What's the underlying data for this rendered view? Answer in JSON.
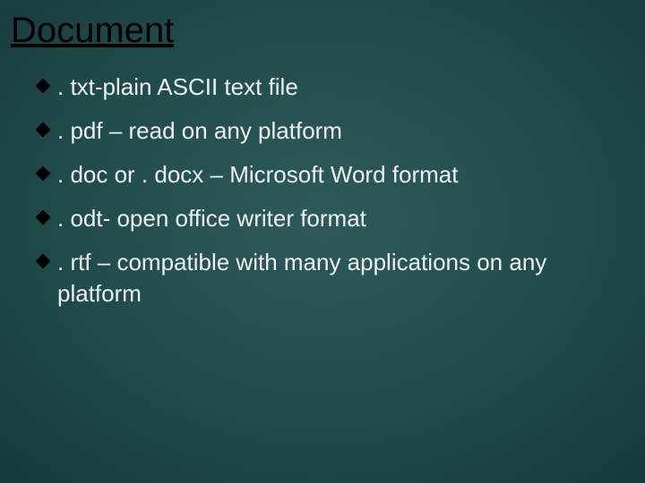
{
  "title": "Document",
  "items": [
    ". txt-plain ASCII text file",
    ". pdf – read on any platform",
    ". doc or . docx – Microsoft Word format",
    ". odt- open office writer format",
    ". rtf – compatible with many applications on any platform"
  ]
}
